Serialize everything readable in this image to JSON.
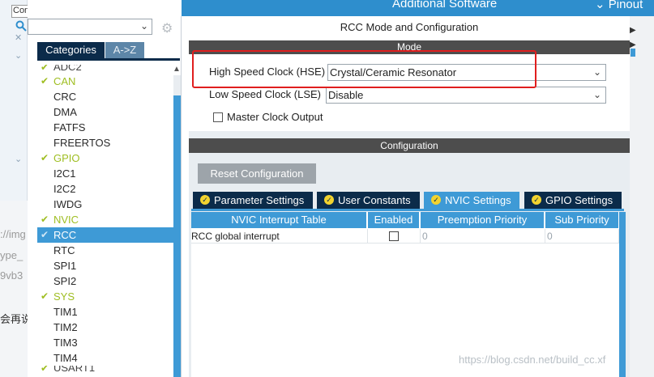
{
  "background_page": {
    "fragments": [
      "Con",
      "://img",
      "ype_",
      "9vb3",
      "会再说"
    ]
  },
  "sidebar": {
    "search": {
      "value": "",
      "placeholder": ""
    },
    "tabs": {
      "categories": "Categories",
      "az": "A->Z"
    },
    "items": [
      {
        "label": "ADC2",
        "status": "ok",
        "partial": true
      },
      {
        "label": "CAN",
        "status": "ok"
      },
      {
        "label": "CRC",
        "status": "none"
      },
      {
        "label": "DMA",
        "status": "none"
      },
      {
        "label": "FATFS",
        "status": "none"
      },
      {
        "label": "FREERTOS",
        "status": "none"
      },
      {
        "label": "GPIO",
        "status": "ok"
      },
      {
        "label": "I2C1",
        "status": "none"
      },
      {
        "label": "I2C2",
        "status": "none"
      },
      {
        "label": "IWDG",
        "status": "none"
      },
      {
        "label": "NVIC",
        "status": "ok"
      },
      {
        "label": "RCC",
        "status": "selected"
      },
      {
        "label": "RTC",
        "status": "none"
      },
      {
        "label": "SPI1",
        "status": "none"
      },
      {
        "label": "SPI2",
        "status": "none"
      },
      {
        "label": "SYS",
        "status": "ok"
      },
      {
        "label": "TIM1",
        "status": "none"
      },
      {
        "label": "TIM2",
        "status": "none"
      },
      {
        "label": "TIM3",
        "status": "none"
      },
      {
        "label": "TIM4",
        "status": "none"
      },
      {
        "label": "USART1",
        "status": "ok",
        "partial": true
      }
    ]
  },
  "header": {
    "title": "Additional Software",
    "pinout": "Pinout"
  },
  "mode": {
    "panel_title": "RCC Mode and Configuration",
    "section_title": "Mode",
    "hse_label": "High Speed Clock (HSE)",
    "hse_value": "Crystal/Ceramic Resonator",
    "lse_label": "Low Speed Clock (LSE)",
    "lse_value": "Disable",
    "mco_label": "Master Clock Output",
    "mco_checked": false
  },
  "configuration": {
    "section_title": "Configuration",
    "reset_label": "Reset Configuration",
    "tabs": [
      {
        "label": "Parameter Settings",
        "active": false
      },
      {
        "label": "User Constants",
        "active": false
      },
      {
        "label": "NVIC Settings",
        "active": true
      },
      {
        "label": "GPIO Settings",
        "active": false
      }
    ],
    "table": {
      "headers": [
        "NVIC Interrupt Table",
        "Enabled",
        "Preemption Priority",
        "Sub Priority"
      ],
      "rows": [
        {
          "name": "RCC global interrupt",
          "enabled": false,
          "preemption": "0",
          "sub": "0"
        }
      ]
    }
  },
  "watermark": "https://blog.csdn.net/build_cc.xf",
  "colors": {
    "accent_blue": "#3e9ad6",
    "header_blue": "#2e8ecd",
    "navy": "#0b2b4a",
    "enabled_green": "#9fbe22",
    "highlight_red": "#e01e1e"
  }
}
